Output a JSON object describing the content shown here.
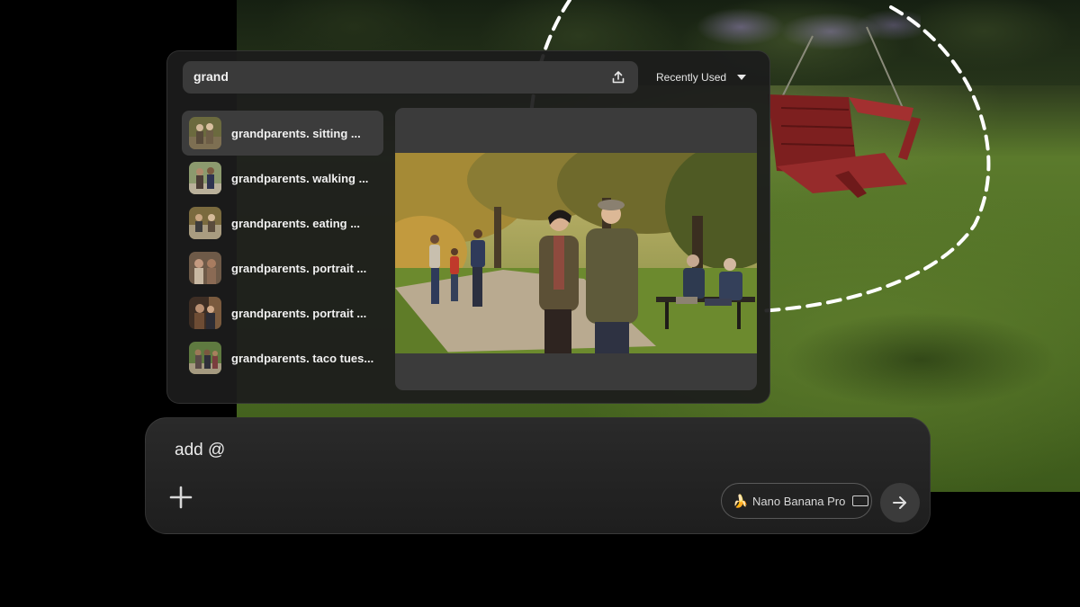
{
  "search": {
    "query": "grand",
    "sort_label": "Recently Used",
    "icons": {
      "upload": "upload-icon",
      "dropdown": "chevron-down-icon"
    }
  },
  "results": [
    {
      "label": "grandparents. sitting ...",
      "selected": true
    },
    {
      "label": "grandparents. walking ...",
      "selected": false
    },
    {
      "label": "grandparents. eating ...",
      "selected": false
    },
    {
      "label": "grandparents. portrait ...",
      "selected": false
    },
    {
      "label": "grandparents. portrait ...",
      "selected": false
    },
    {
      "label": "grandparents. taco tues...",
      "selected": false
    }
  ],
  "composer": {
    "prompt_text": "add @",
    "model_label": "Nano Banana Pro",
    "model_emoji": "🍌",
    "icons": {
      "add": "plus-icon",
      "aspect": "aspect-ratio-icon",
      "send": "arrow-right-icon"
    }
  },
  "colors": {
    "panel": "#1c1c1c",
    "selected_row": "#3c3c3c",
    "composer": "#242424",
    "swing": "#8e2424"
  }
}
